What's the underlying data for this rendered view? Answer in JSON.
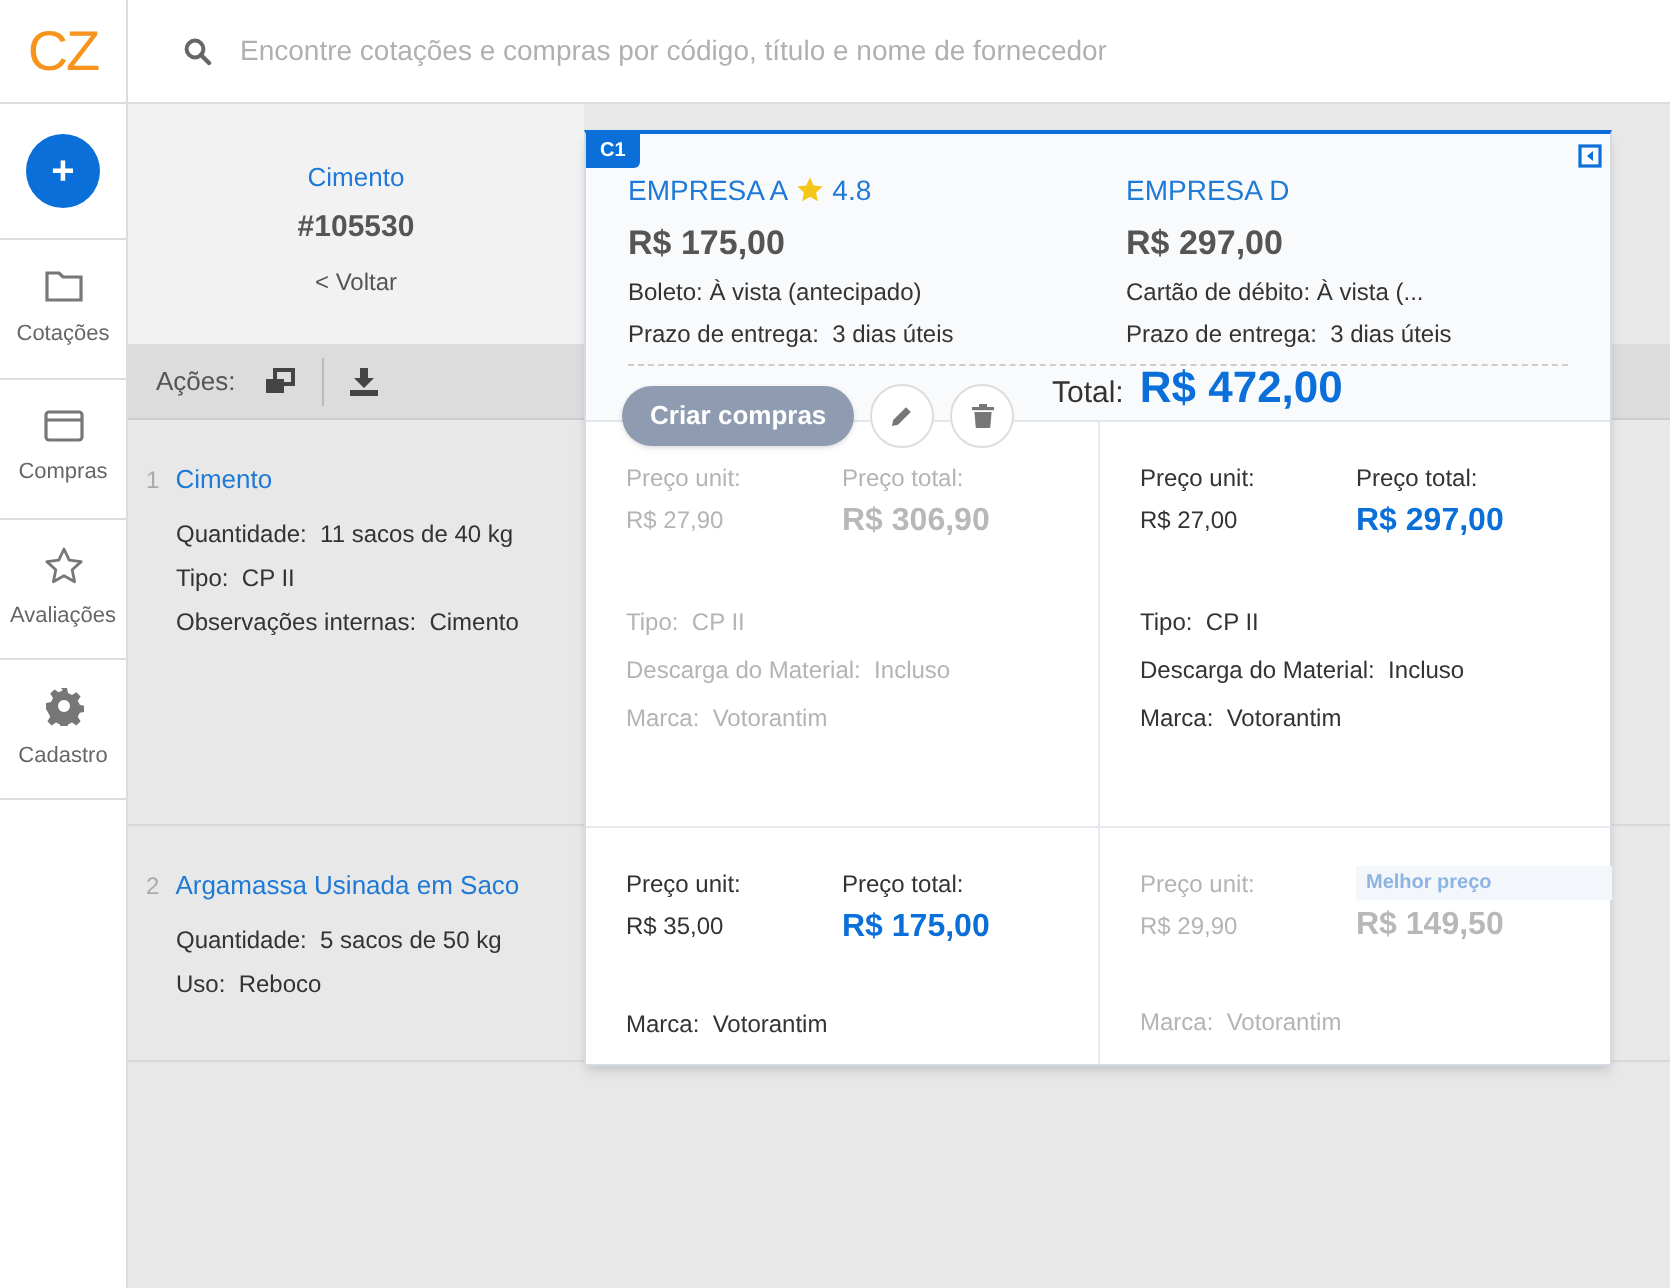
{
  "logo": "CZ",
  "search": {
    "placeholder": "Encontre cotações e compras por código, título e nome de fornecedor"
  },
  "nav": {
    "new_button": "+",
    "items": [
      {
        "label": "Cotações"
      },
      {
        "label": "Compras"
      },
      {
        "label": "Avaliações"
      },
      {
        "label": "Cadastro"
      }
    ]
  },
  "quote": {
    "title": "Cimento",
    "number": "#105530",
    "back": "< Voltar"
  },
  "actions": {
    "label": "Ações:"
  },
  "items": [
    {
      "index": "1",
      "name": "Cimento",
      "fields": [
        {
          "label": "Quantidade:",
          "value": "11 sacos de 40 kg"
        },
        {
          "label": "Tipo:",
          "value": "CP II"
        },
        {
          "label": "Observações internas:",
          "value": "Cimento"
        }
      ]
    },
    {
      "index": "2",
      "name": "Argamassa Usinada em Saco",
      "fields": [
        {
          "label": "Quantidade:",
          "value": "5 sacos de 50 kg"
        },
        {
          "label": "Uso:",
          "value": "Reboco"
        }
      ]
    }
  ],
  "comparison": {
    "tag": "C1",
    "total_label": "Total:",
    "total": "R$ 472,00",
    "create_button": "Criar compras",
    "suppliers": [
      {
        "name": "EMPRESA A",
        "rating": "4.8",
        "price": "R$ 175,00",
        "payment": "Boleto: À vista (antecipado)",
        "delivery_label": "Prazo de entrega:",
        "delivery": "3 dias úteis",
        "offers": [
          {
            "selected": false,
            "unit_label": "Preço unit:",
            "unit": "R$ 27,90",
            "total_label": "Preço total:",
            "total": "R$ 306,90",
            "fields": [
              {
                "label": "Tipo:",
                "value": "CP II"
              },
              {
                "label": "Descarga do Material:",
                "value": "Incluso"
              },
              {
                "label": "Marca:",
                "value": "Votorantim"
              }
            ]
          },
          {
            "selected": true,
            "unit_label": "Preço unit:",
            "unit": "R$ 35,00",
            "total_label": "Preço total:",
            "total": "R$ 175,00",
            "fields": [
              {
                "label": "Marca:",
                "value": "Votorantim"
              }
            ]
          }
        ]
      },
      {
        "name": "EMPRESA D",
        "price": "R$ 297,00",
        "payment": "Cartão de débito: À vista (...",
        "delivery_label": "Prazo de entrega:",
        "delivery": "3 dias úteis",
        "offers": [
          {
            "selected": true,
            "unit_label": "Preço unit:",
            "unit": "R$ 27,00",
            "total_label": "Preço total:",
            "total": "R$ 297,00",
            "fields": [
              {
                "label": "Tipo:",
                "value": "CP II"
              },
              {
                "label": "Descarga do Material:",
                "value": "Incluso"
              },
              {
                "label": "Marca:",
                "value": "Votorantim"
              }
            ]
          },
          {
            "selected": false,
            "badge": "Melhor preço",
            "unit_label": "Preço unit:",
            "unit": "R$ 29,90",
            "total": "R$ 149,50",
            "fields": [
              {
                "label": "Marca:",
                "value": "Votorantim"
              }
            ]
          }
        ]
      }
    ]
  }
}
